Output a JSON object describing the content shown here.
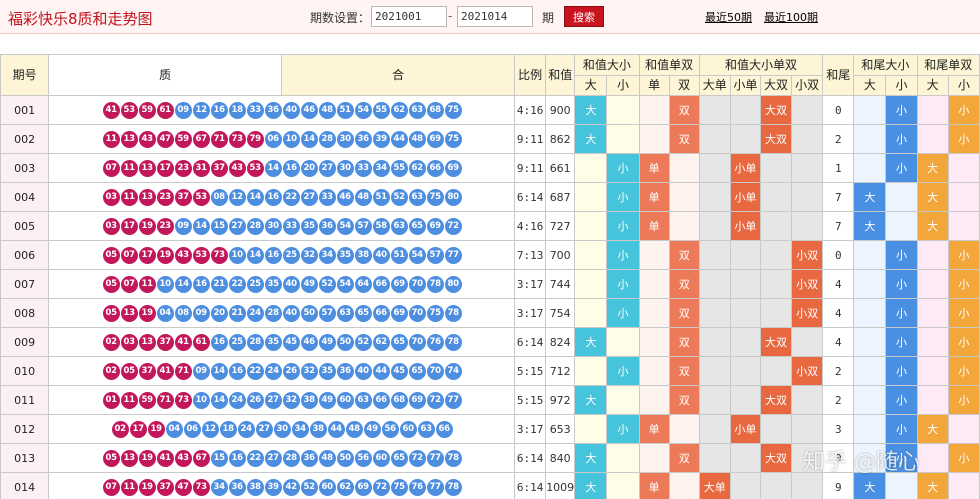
{
  "header": {
    "title": "福彩快乐8质和走势图",
    "period_label": "期数设置：",
    "start": "2021001",
    "end": "2021014",
    "dash": "-",
    "period_unit": "期",
    "search": "搜索",
    "last50": "最近50期",
    "last100": "最近100期"
  },
  "columns": {
    "issue": "期号",
    "prime": "质",
    "composite": "合",
    "ratio": "比例",
    "sum": "和值",
    "sum_bs": "和值大小",
    "sum_oe": "和值单双",
    "sum_combo": "和值大小单双",
    "tail": "和尾",
    "tail_bs": "和尾大小",
    "tail_oe": "和尾单双",
    "big": "大",
    "small": "小",
    "odd": "单",
    "even": "双",
    "big_odd": "大单",
    "small_odd": "小单",
    "big_even": "大双",
    "small_even": "小双"
  },
  "rows": [
    {
      "issue": "001",
      "primes": [
        "41",
        "53",
        "59",
        "61"
      ],
      "composites": [
        "09",
        "12",
        "16",
        "18",
        "33",
        "36",
        "40",
        "46",
        "48",
        "51",
        "54",
        "55",
        "62",
        "63",
        "68",
        "75"
      ],
      "ratio": "4:16",
      "sum": "900",
      "sbs": "大",
      "soe": "双",
      "combo": "大双",
      "tail": "0",
      "tbs": "小",
      "toe": "小"
    },
    {
      "issue": "002",
      "primes": [
        "11",
        "13",
        "43",
        "47",
        "59",
        "67",
        "71",
        "73",
        "79"
      ],
      "composites": [
        "06",
        "10",
        "14",
        "28",
        "30",
        "36",
        "39",
        "44",
        "48",
        "69",
        "75"
      ],
      "ratio": "9:11",
      "sum": "862",
      "sbs": "大",
      "soe": "双",
      "combo": "大双",
      "tail": "2",
      "tbs": "小",
      "toe": "小"
    },
    {
      "issue": "003",
      "primes": [
        "07",
        "11",
        "13",
        "17",
        "23",
        "31",
        "37",
        "43",
        "53"
      ],
      "composites": [
        "14",
        "16",
        "20",
        "27",
        "30",
        "33",
        "34",
        "55",
        "62",
        "66",
        "69"
      ],
      "ratio": "9:11",
      "sum": "661",
      "sbs": "小",
      "soe": "单",
      "combo": "小单",
      "tail": "1",
      "tbs": "小",
      "toe": "大"
    },
    {
      "issue": "004",
      "primes": [
        "03",
        "11",
        "13",
        "23",
        "37",
        "53"
      ],
      "composites": [
        "08",
        "12",
        "14",
        "16",
        "22",
        "27",
        "33",
        "46",
        "48",
        "51",
        "52",
        "63",
        "75",
        "80"
      ],
      "ratio": "6:14",
      "sum": "687",
      "sbs": "小",
      "soe": "单",
      "combo": "小单",
      "tail": "7",
      "tbs": "大",
      "toe": "大"
    },
    {
      "issue": "005",
      "primes": [
        "03",
        "17",
        "19",
        "23"
      ],
      "composites": [
        "09",
        "14",
        "15",
        "27",
        "28",
        "30",
        "33",
        "35",
        "36",
        "54",
        "57",
        "58",
        "63",
        "65",
        "69",
        "72"
      ],
      "ratio": "4:16",
      "sum": "727",
      "sbs": "小",
      "soe": "单",
      "combo": "小单",
      "tail": "7",
      "tbs": "大",
      "toe": "大"
    },
    {
      "issue": "006",
      "primes": [
        "05",
        "07",
        "17",
        "19",
        "43",
        "53",
        "73"
      ],
      "composites": [
        "10",
        "14",
        "16",
        "25",
        "32",
        "34",
        "35",
        "38",
        "40",
        "51",
        "54",
        "57",
        "77"
      ],
      "ratio": "7:13",
      "sum": "700",
      "sbs": "小",
      "soe": "双",
      "combo": "小双",
      "tail": "0",
      "tbs": "小",
      "toe": "小"
    },
    {
      "issue": "007",
      "primes": [
        "05",
        "07",
        "11"
      ],
      "composites": [
        "10",
        "14",
        "16",
        "21",
        "22",
        "25",
        "35",
        "40",
        "49",
        "52",
        "54",
        "64",
        "66",
        "69",
        "70",
        "78",
        "80"
      ],
      "ratio": "3:17",
      "sum": "744",
      "sbs": "小",
      "soe": "双",
      "combo": "小双",
      "tail": "4",
      "tbs": "小",
      "toe": "小"
    },
    {
      "issue": "008",
      "primes": [
        "05",
        "13",
        "19"
      ],
      "composites": [
        "04",
        "08",
        "09",
        "20",
        "21",
        "24",
        "28",
        "40",
        "50",
        "57",
        "63",
        "65",
        "66",
        "69",
        "70",
        "75",
        "78"
      ],
      "ratio": "3:17",
      "sum": "754",
      "sbs": "小",
      "soe": "双",
      "combo": "小双",
      "tail": "4",
      "tbs": "小",
      "toe": "小"
    },
    {
      "issue": "009",
      "primes": [
        "02",
        "03",
        "13",
        "37",
        "41",
        "61"
      ],
      "composites": [
        "16",
        "25",
        "28",
        "35",
        "45",
        "46",
        "49",
        "50",
        "52",
        "62",
        "65",
        "70",
        "76",
        "78"
      ],
      "ratio": "6:14",
      "sum": "824",
      "sbs": "大",
      "soe": "双",
      "combo": "大双",
      "tail": "4",
      "tbs": "小",
      "toe": "小"
    },
    {
      "issue": "010",
      "primes": [
        "02",
        "05",
        "37",
        "41",
        "71"
      ],
      "composites": [
        "09",
        "14",
        "16",
        "22",
        "24",
        "26",
        "32",
        "35",
        "36",
        "40",
        "44",
        "45",
        "65",
        "70",
        "74"
      ],
      "ratio": "5:15",
      "sum": "712",
      "sbs": "小",
      "soe": "双",
      "combo": "小双",
      "tail": "2",
      "tbs": "小",
      "toe": "小"
    },
    {
      "issue": "011",
      "primes": [
        "01",
        "11",
        "59",
        "71",
        "73"
      ],
      "composites": [
        "10",
        "14",
        "24",
        "26",
        "27",
        "32",
        "38",
        "49",
        "60",
        "63",
        "66",
        "68",
        "69",
        "72",
        "77"
      ],
      "ratio": "5:15",
      "sum": "972",
      "sbs": "大",
      "soe": "双",
      "combo": "大双",
      "tail": "2",
      "tbs": "小",
      "toe": "小"
    },
    {
      "issue": "012",
      "primes": [
        "02",
        "17",
        "19"
      ],
      "composites": [
        "04",
        "06",
        "12",
        "18",
        "24",
        "27",
        "30",
        "34",
        "38",
        "44",
        "48",
        "49",
        "56",
        "60",
        "63",
        "66"
      ],
      "ratio": "3:17",
      "sum": "653",
      "sbs": "小",
      "soe": "单",
      "combo": "小单",
      "tail": "3",
      "tbs": "小",
      "toe": "大"
    },
    {
      "issue": "013",
      "primes": [
        "05",
        "13",
        "19",
        "41",
        "43",
        "67"
      ],
      "composites": [
        "15",
        "16",
        "22",
        "27",
        "28",
        "36",
        "48",
        "50",
        "56",
        "60",
        "65",
        "72",
        "77",
        "78"
      ],
      "ratio": "6:14",
      "sum": "840",
      "sbs": "大",
      "soe": "双",
      "combo": "大双",
      "tail": "0",
      "tbs": "小",
      "toe": "小"
    },
    {
      "issue": "014",
      "primes": [
        "07",
        "11",
        "19",
        "37",
        "47",
        "73"
      ],
      "composites": [
        "34",
        "36",
        "38",
        "39",
        "42",
        "52",
        "60",
        "62",
        "69",
        "72",
        "75",
        "76",
        "77",
        "78"
      ],
      "ratio": "6:14",
      "sum": "1009",
      "sbs": "大",
      "soe": "单",
      "combo": "大单",
      "tail": "9",
      "tbs": "大",
      "toe": "大"
    }
  ],
  "watermark": "知乎 @随心",
  "colors": {
    "prime_ball": "#c2185b",
    "composite_ball": "#4d8ee0",
    "sum_size": "#45c4dc",
    "sum_parity": "#ec7a58",
    "combo": "#e86840",
    "tail_size": "#4a90e2",
    "tail_parity": "#f3a73a"
  }
}
